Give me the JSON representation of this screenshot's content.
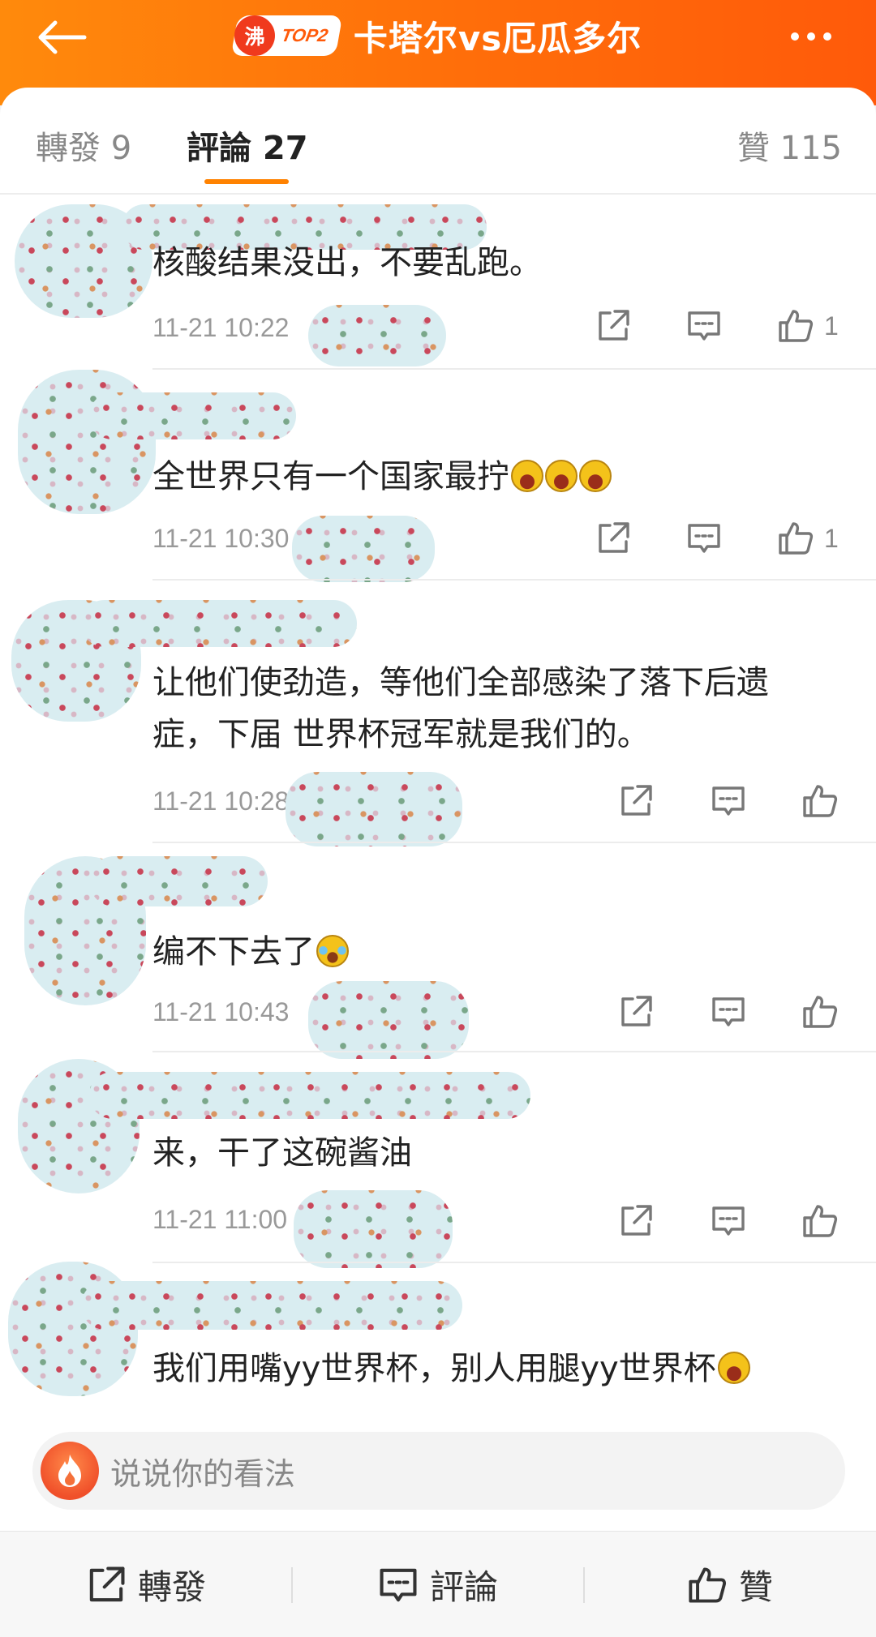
{
  "header": {
    "title": "卡塔尔vs厄瓜多尔",
    "hot_badge_char": "沸",
    "hot_badge_rank": "TOP2",
    "back_icon": "arrow-left-icon",
    "more_icon": "more-dots-icon"
  },
  "tabs": {
    "repost": "轉發 9",
    "comments": "評論 27",
    "likes": "贊 115"
  },
  "comments": [
    {
      "text": "核酸结果没出，不要乱跑。",
      "time": "11-21 10:22",
      "likes": "1"
    },
    {
      "text": "全世界只有一个国家最拧",
      "time": "11-21 10:30",
      "likes": "1"
    },
    {
      "text_line1": "让他们使劲造，等他们全部感染了落下后遗",
      "text_line2": "症，下届 世界杯冠军就是我们的。",
      "time": "11-21 10:28",
      "likes": ""
    },
    {
      "text": "编不下去了",
      "time": "11-21 10:43",
      "likes": ""
    },
    {
      "text": "来，干了这碗酱油",
      "time": "11-21 11:00",
      "likes": ""
    },
    {
      "text": "我们用嘴yy世界杯，别人用腿yy世界杯",
      "time": "",
      "likes": ""
    }
  ],
  "input": {
    "placeholder": "说说你的看法"
  },
  "bottom": {
    "repost": "轉發",
    "comment": "評論",
    "like": "贊"
  },
  "colors": {
    "header_gradient_start": "#ff8a0c",
    "header_gradient_end": "#ff5a0a",
    "tab_underline": "#ff8200",
    "text_primary": "#222222",
    "text_secondary": "#999999"
  }
}
